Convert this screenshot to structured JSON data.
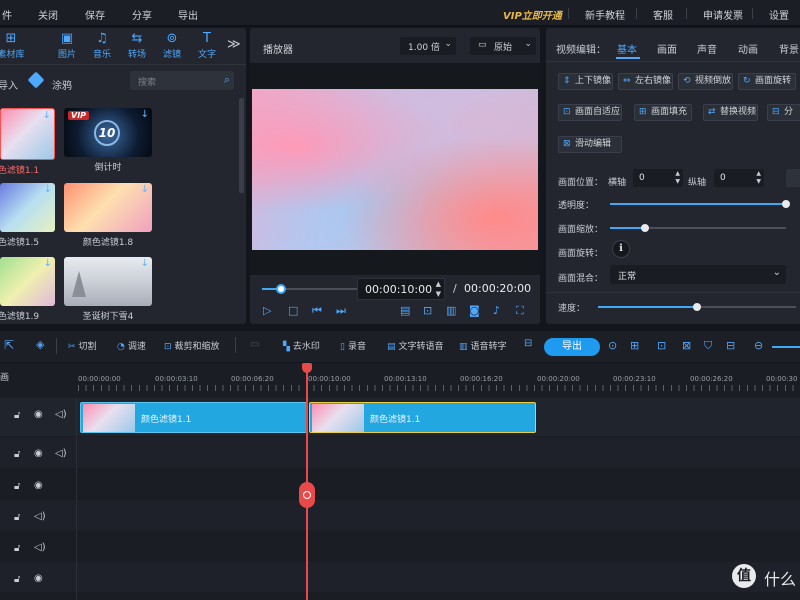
{
  "menu": {
    "left": [
      "件",
      "关闭",
      "保存",
      "分享",
      "导出"
    ],
    "vip": "VIP立即开通",
    "right": [
      "新手教程",
      "客服",
      "申请发票",
      "设置"
    ]
  },
  "library": {
    "tabs": [
      {
        "icon": "⊞",
        "label": "素材库"
      },
      {
        "icon": "▣",
        "label": "图片"
      },
      {
        "icon": "♫",
        "label": "音乐"
      },
      {
        "icon": "⇆",
        "label": "转场"
      },
      {
        "icon": "⊚",
        "label": "滤镜"
      },
      {
        "icon": "T",
        "label": "文字"
      }
    ],
    "more": "≫",
    "import_label": "导入",
    "paint_label": "涂鸦",
    "search_placeholder": "搜索",
    "items": [
      {
        "label": "颜色滤镜1.1",
        "selected": true
      },
      {
        "label": "倒计时",
        "badge": "VIP",
        "number": "10"
      },
      {
        "label": "颜色滤镜1.5"
      },
      {
        "label": "颜色滤镜1.8"
      },
      {
        "label": "颜色滤镜1.9"
      },
      {
        "label": "圣诞树下雪4"
      }
    ]
  },
  "player": {
    "title": "播放器",
    "speed": "1.00 倍",
    "ratio": "原始",
    "current_time": "00:00:10:00",
    "separator": "/",
    "total_time": "00:00:20:00",
    "progress": 0.18
  },
  "props": {
    "header": "视频编辑：",
    "tabs": [
      "基本",
      "画面",
      "声音",
      "动画",
      "背景"
    ],
    "active_tab": "基本",
    "buttons_row1": [
      "上下镜像",
      "左右镜像",
      "视频倒放",
      "画面旋转"
    ],
    "buttons_row2": [
      "画面自适应",
      "画面填充",
      "替换视频",
      "分"
    ],
    "button_row3": "滑动编辑",
    "position_label": "画面位置：",
    "x_label": "横轴",
    "x_value": "0",
    "y_label": "纵轴",
    "y_value": "0",
    "opacity_label": "透明度：",
    "opacity": 1.0,
    "scale_label": "画面缩放：",
    "scale": 0.2,
    "rotate_label": "画面旋转：",
    "rotate_icon": "ℹ",
    "blend_label": "画面混合：",
    "blend_value": "正常",
    "speed_label": "速度：",
    "speed": 0.5
  },
  "timeline_toolbar": {
    "cut": "切割",
    "speed": "调速",
    "crop": "裁剪和缩放",
    "dewatermark": "去水印",
    "record": "录音",
    "tts": "文字转语音",
    "stt": "语音转字",
    "export": "导出"
  },
  "timeline": {
    "left_label": "画",
    "ruler": [
      "00:00:00:00",
      "00:00:03:10",
      "00:00:06:20",
      "00:00:10:00",
      "00:00:13:10",
      "00:00:16:20",
      "00:00:20:00",
      "00:00:23:10",
      "00:00:26:20",
      "00:00:30"
    ],
    "clips": [
      {
        "name": "颜色滤镜1.1"
      },
      {
        "name": "颜色滤镜1.1"
      }
    ]
  },
  "watermark": {
    "symbol": "值",
    "text": "什么"
  }
}
